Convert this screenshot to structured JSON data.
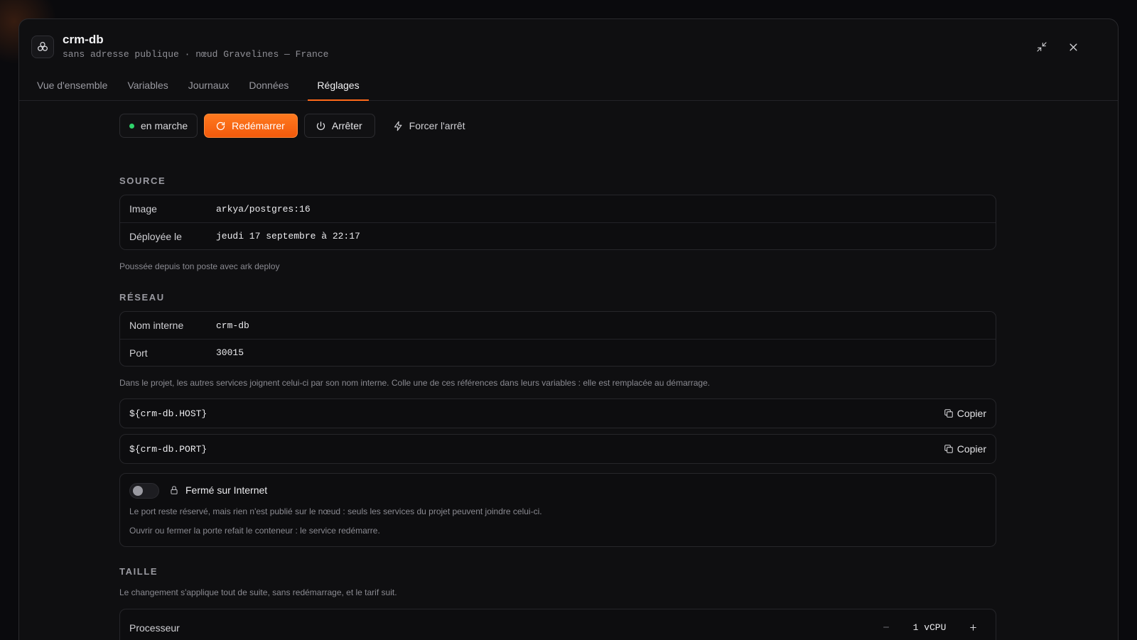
{
  "service": {
    "name": "crm-db",
    "subtitle": "sans adresse publique · nœud Gravelines — France"
  },
  "tabs": [
    {
      "label": "Vue d'ensemble"
    },
    {
      "label": "Variables"
    },
    {
      "label": "Journaux"
    },
    {
      "label": "Données"
    },
    {
      "label": "Réglages",
      "active": true
    }
  ],
  "actions": {
    "status": "en marche",
    "status_color": "#2fd36b",
    "restart": "Redémarrer",
    "stop": "Arrêter",
    "force_stop": "Forcer l'arrêt",
    "accent": "#ff6a1a"
  },
  "source": {
    "title": "SOURCE",
    "rows": [
      {
        "key": "Image",
        "value": "arkya/postgres:16"
      },
      {
        "key": "Déployée le",
        "value": "jeudi 17 septembre à 22:17"
      }
    ],
    "note": "Poussée depuis ton poste avec ark deploy"
  },
  "network": {
    "title": "RÉSEAU",
    "rows": [
      {
        "key": "Nom interne",
        "value": "crm-db"
      },
      {
        "key": "Port",
        "value": "30015"
      }
    ],
    "note": "Dans le projet, les autres services joignent celui-ci par son nom interne. Colle une de ces références dans leurs variables : elle est remplacée au démarrage.",
    "refs": [
      {
        "code": "${crm-db.HOST}",
        "copy": "Copier"
      },
      {
        "code": "${crm-db.PORT}",
        "copy": "Copier"
      }
    ],
    "exposure": {
      "label": "Fermé sur Internet",
      "enabled": false,
      "desc1": "Le port reste réservé, mais rien n'est publié sur le nœud : seuls les services du projet peuvent joindre celui-ci.",
      "desc2": "Ouvrir ou fermer la porte refait le conteneur : le service redémarre."
    }
  },
  "size": {
    "title": "TAILLE",
    "note": "Le changement s'applique tout de suite, sans redémarrage, et le tarif suit.",
    "processor_label": "Processeur",
    "processor_value": "1 vCPU"
  }
}
